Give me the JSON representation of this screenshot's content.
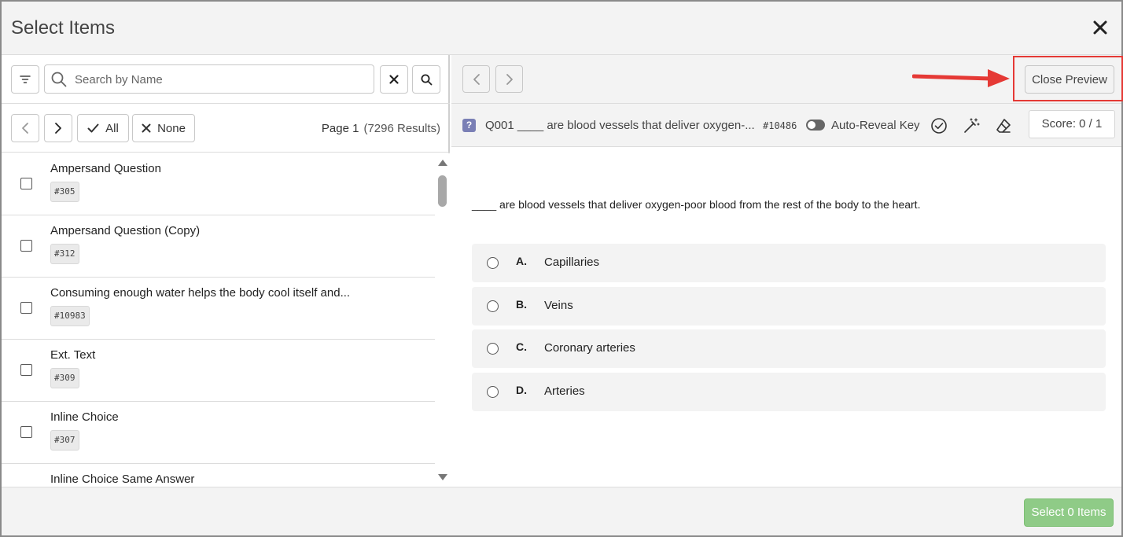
{
  "dialog": {
    "title": "Select Items"
  },
  "left": {
    "search": {
      "placeholder": "Search by Name",
      "value": ""
    },
    "pager": {
      "all_label": "All",
      "none_label": "None",
      "page_label": "Page 1",
      "results_label": "(7296 Results)"
    },
    "items": [
      {
        "name": "Ampersand Question",
        "tag": "#305"
      },
      {
        "name": "Ampersand Question (Copy)",
        "tag": "#312"
      },
      {
        "name": "Consuming enough water helps the body cool itself and...",
        "tag": "#10983"
      },
      {
        "name": "Ext. Text",
        "tag": "#309"
      },
      {
        "name": "Inline Choice",
        "tag": "#307"
      },
      {
        "name": "Inline Choice Same Answer",
        "tag": ""
      }
    ]
  },
  "right": {
    "close_preview_label": "Close Preview",
    "question": {
      "icon_glyph": "?",
      "title": "Q001 ____ are blood vessels that deliver oxygen-...",
      "id": "#10486",
      "auto_reveal_label": "Auto-Reveal Key",
      "score_label": "Score: 0 / 1",
      "stem": "____ are blood vessels that deliver oxygen-poor blood from the rest of the body to the heart.",
      "choices": [
        {
          "letter": "A.",
          "text": "Capillaries"
        },
        {
          "letter": "B.",
          "text": "Veins"
        },
        {
          "letter": "C.",
          "text": "Coronary arteries"
        },
        {
          "letter": "D.",
          "text": "Arteries"
        }
      ]
    }
  },
  "footer": {
    "select_label": "Select 0 Items"
  },
  "icons": {
    "close": "close-icon",
    "filter": "filter-icon",
    "search": "search-icon",
    "clear": "x-icon",
    "prev": "chevron-left-icon",
    "next": "chevron-right-icon",
    "check": "check-circle-icon",
    "wand": "magic-wand-icon",
    "eraser": "eraser-icon"
  },
  "colors": {
    "accent_green": "#8fcb87",
    "highlight_red": "#e53935",
    "question_icon": "#7a7fb5"
  }
}
